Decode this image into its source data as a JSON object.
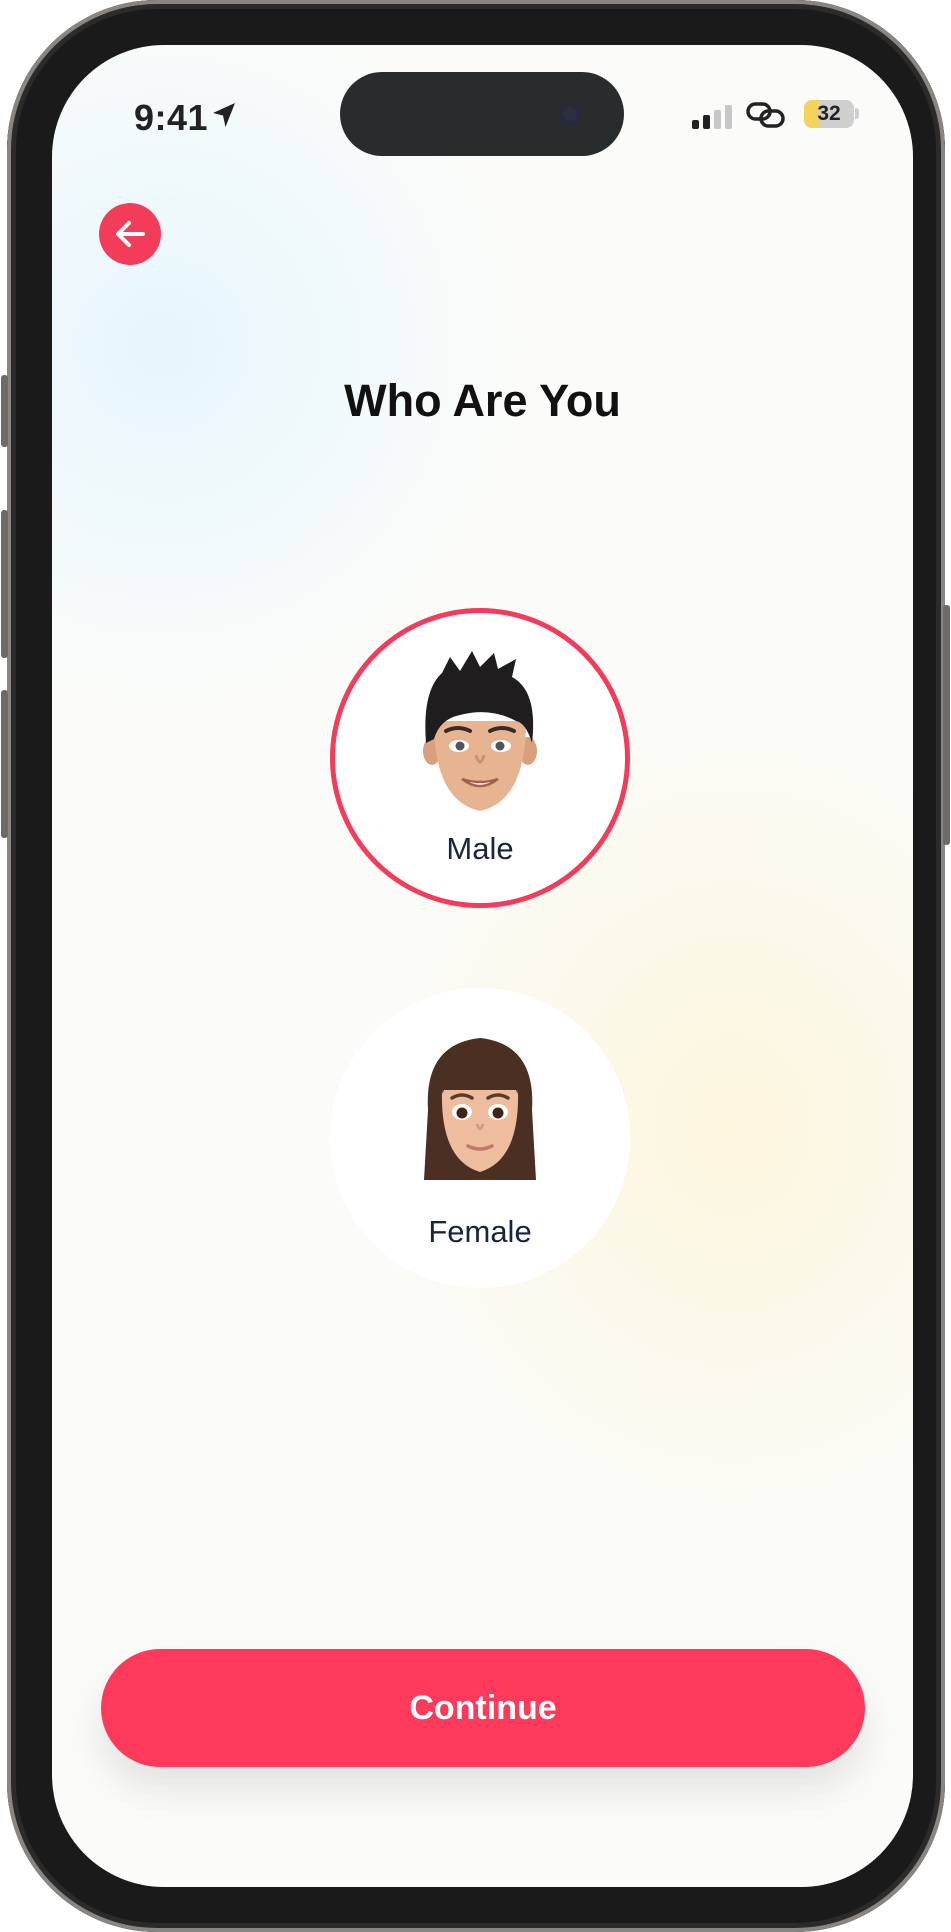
{
  "status_bar": {
    "time": "9:41",
    "battery_percent": "32",
    "battery_level": 0.32,
    "icons": [
      "location-arrow-icon",
      "signal-icon",
      "link-icon",
      "battery-icon"
    ]
  },
  "header": {
    "back_icon": "arrow-left-icon",
    "title": "Who Are You"
  },
  "options": [
    {
      "label": "Male",
      "selected": true,
      "icon": "male-avatar-icon"
    },
    {
      "label": "Female",
      "selected": false,
      "icon": "female-avatar-icon"
    }
  ],
  "footer": {
    "continue_label": "Continue"
  },
  "colors": {
    "accent": "#fd3a5b",
    "text_dark": "#111111",
    "label_navy": "#1a2340"
  }
}
